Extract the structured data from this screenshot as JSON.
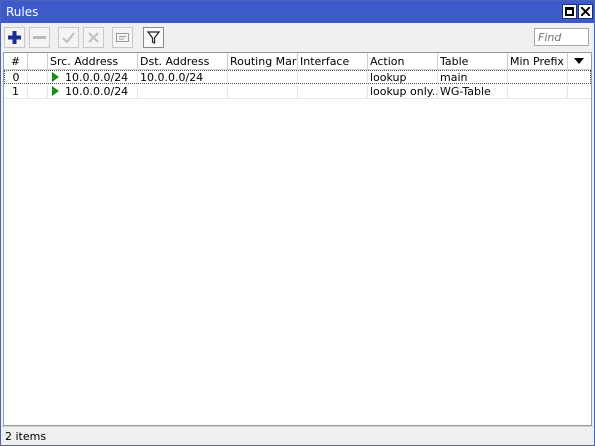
{
  "window": {
    "title": "Rules"
  },
  "toolbar": {
    "add": "add-icon",
    "remove": "remove-icon",
    "enable": "check-icon",
    "disable": "x-icon",
    "comment": "comment-icon",
    "filter": "filter-icon"
  },
  "search": {
    "placeholder": "Find",
    "value": ""
  },
  "table": {
    "columns": [
      "#",
      "",
      "Src. Address",
      "Dst. Address",
      "Routing Mark",
      "Interface",
      "Action",
      "Table",
      "Min Prefix"
    ],
    "rows": [
      {
        "num": "0",
        "flag": "",
        "src": "10.0.0.0/24",
        "dst": "10.0.0.0/24",
        "mark": "",
        "iface": "",
        "action": "lookup",
        "table": "main",
        "prefix": ""
      },
      {
        "num": "1",
        "flag": "",
        "src": "10.0.0.0/24",
        "dst": "",
        "mark": "",
        "iface": "",
        "action": "lookup only...",
        "table": "WG-Table",
        "prefix": ""
      }
    ]
  },
  "status": {
    "items": "2 items"
  },
  "colors": {
    "titlebar": "#3c5aca",
    "enabled_arrow": "#1a8a1a",
    "add_icon": "#1b2f9a"
  }
}
